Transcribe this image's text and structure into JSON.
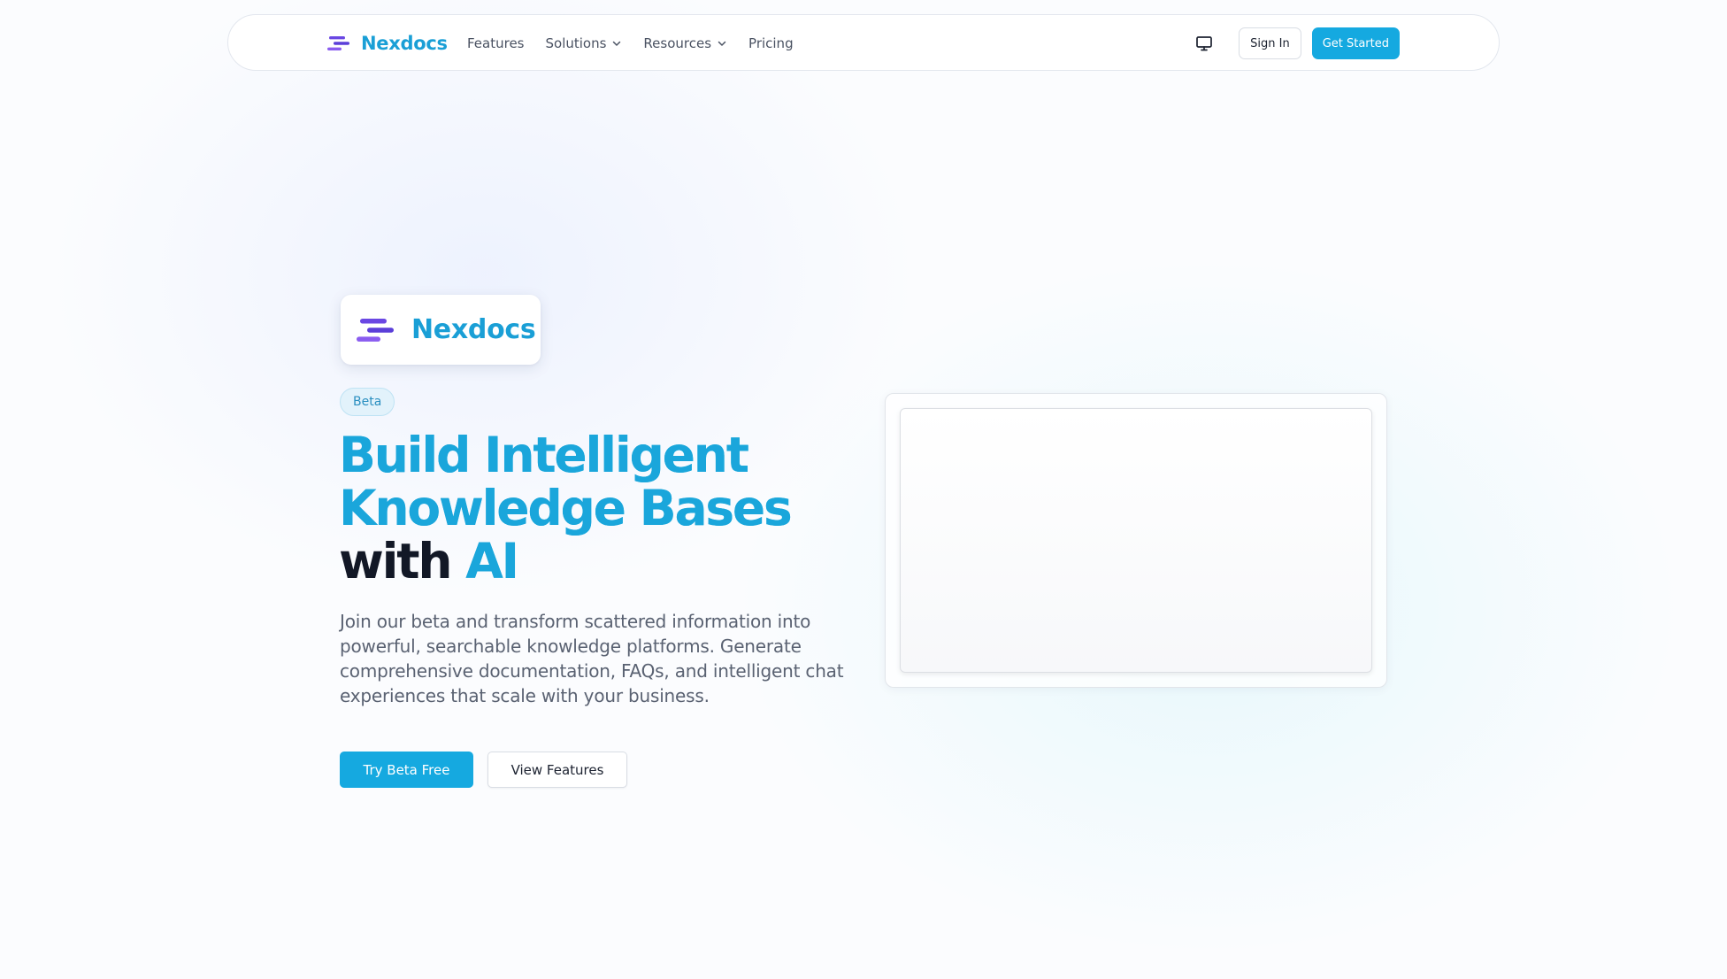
{
  "brand": {
    "name": "Nexdocs",
    "mark_colors": [
      "#5b3fd9",
      "#8a5cf0"
    ]
  },
  "nav": {
    "links": [
      {
        "label": "Features",
        "dropdown": false
      },
      {
        "label": "Solutions",
        "dropdown": true
      },
      {
        "label": "Resources",
        "dropdown": true
      },
      {
        "label": "Pricing",
        "dropdown": false
      }
    ],
    "theme_icon": "monitor-icon",
    "sign_in_label": "Sign In",
    "get_started_label": "Get Started"
  },
  "hero": {
    "badge": "Beta",
    "headline_line1": "Build Intelligent",
    "headline_line2": "Knowledge Bases",
    "headline_line3_dark": "with",
    "headline_line3_accent": "AI",
    "description": "Join our beta and transform scattered information into powerful, searchable knowledge platforms. Generate comprehensive documentation, FAQs, and intelligent chat experiences that scale with your business.",
    "primary_cta": "Try Beta Free",
    "secondary_cta": "View Features"
  },
  "colors": {
    "accent": "#15a9e0",
    "brand_text": "#1a9fd6",
    "headline_dark": "#121826"
  }
}
